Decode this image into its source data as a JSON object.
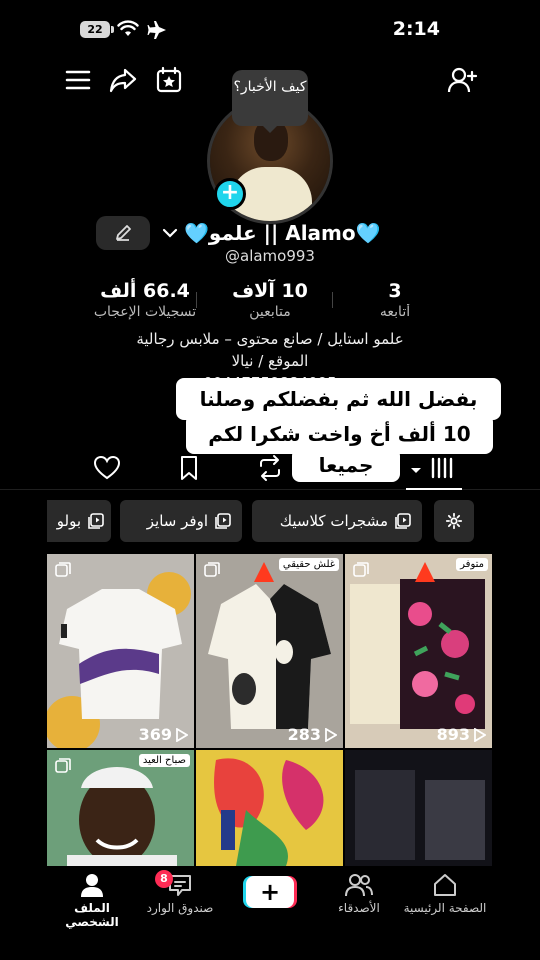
{
  "status_bar": {
    "battery": "22",
    "time": "2:14"
  },
  "avatar_bubble": "كيف الأخبار؟",
  "profile": {
    "display_name": "🩵علمو || Alamo🩵",
    "username": "@alamo993"
  },
  "stats": [
    {
      "value": "3",
      "label": "أتابعه"
    },
    {
      "value": "10 آلاف",
      "label": "متابعين"
    },
    {
      "value": "66.4 ألف",
      "label": "تسجيلات الإعجاب"
    }
  ],
  "bio": {
    "line1": "علمو استايل / صانع محتوى – ملابس رجالية",
    "line2": "الموقع / نيالا",
    "line3": "00447759884095"
  },
  "overlay_text": {
    "line1": "بفضل الله ثم بفضلكم وصلنا",
    "line2": "10 ألف أخ واخت شكرا لكم",
    "line3": "جميعا"
  },
  "chips": [
    "مشجرات كلاسيك",
    "اوفر سايز",
    "بولو"
  ],
  "videos": [
    {
      "views": "893",
      "tag": "متوفر"
    },
    {
      "views": "283",
      "tag": "غلش حقيقي"
    },
    {
      "views": "369",
      "tag": ""
    },
    {
      "views": "",
      "tag": ""
    },
    {
      "views": "",
      "tag": ""
    },
    {
      "views": "",
      "tag": "صباح العيد"
    }
  ],
  "bottom_nav": {
    "home": "الصفحة الرئيسية",
    "friends": "الأصدقاء",
    "create": "+",
    "inbox": "صندوق الوارد",
    "inbox_badge": "8",
    "profile": "الملف الشخصي"
  },
  "colors": {
    "accent_cyan": "#20d5ec",
    "accent_red": "#fe2c55",
    "heart_blue": "#7fd3f5"
  }
}
